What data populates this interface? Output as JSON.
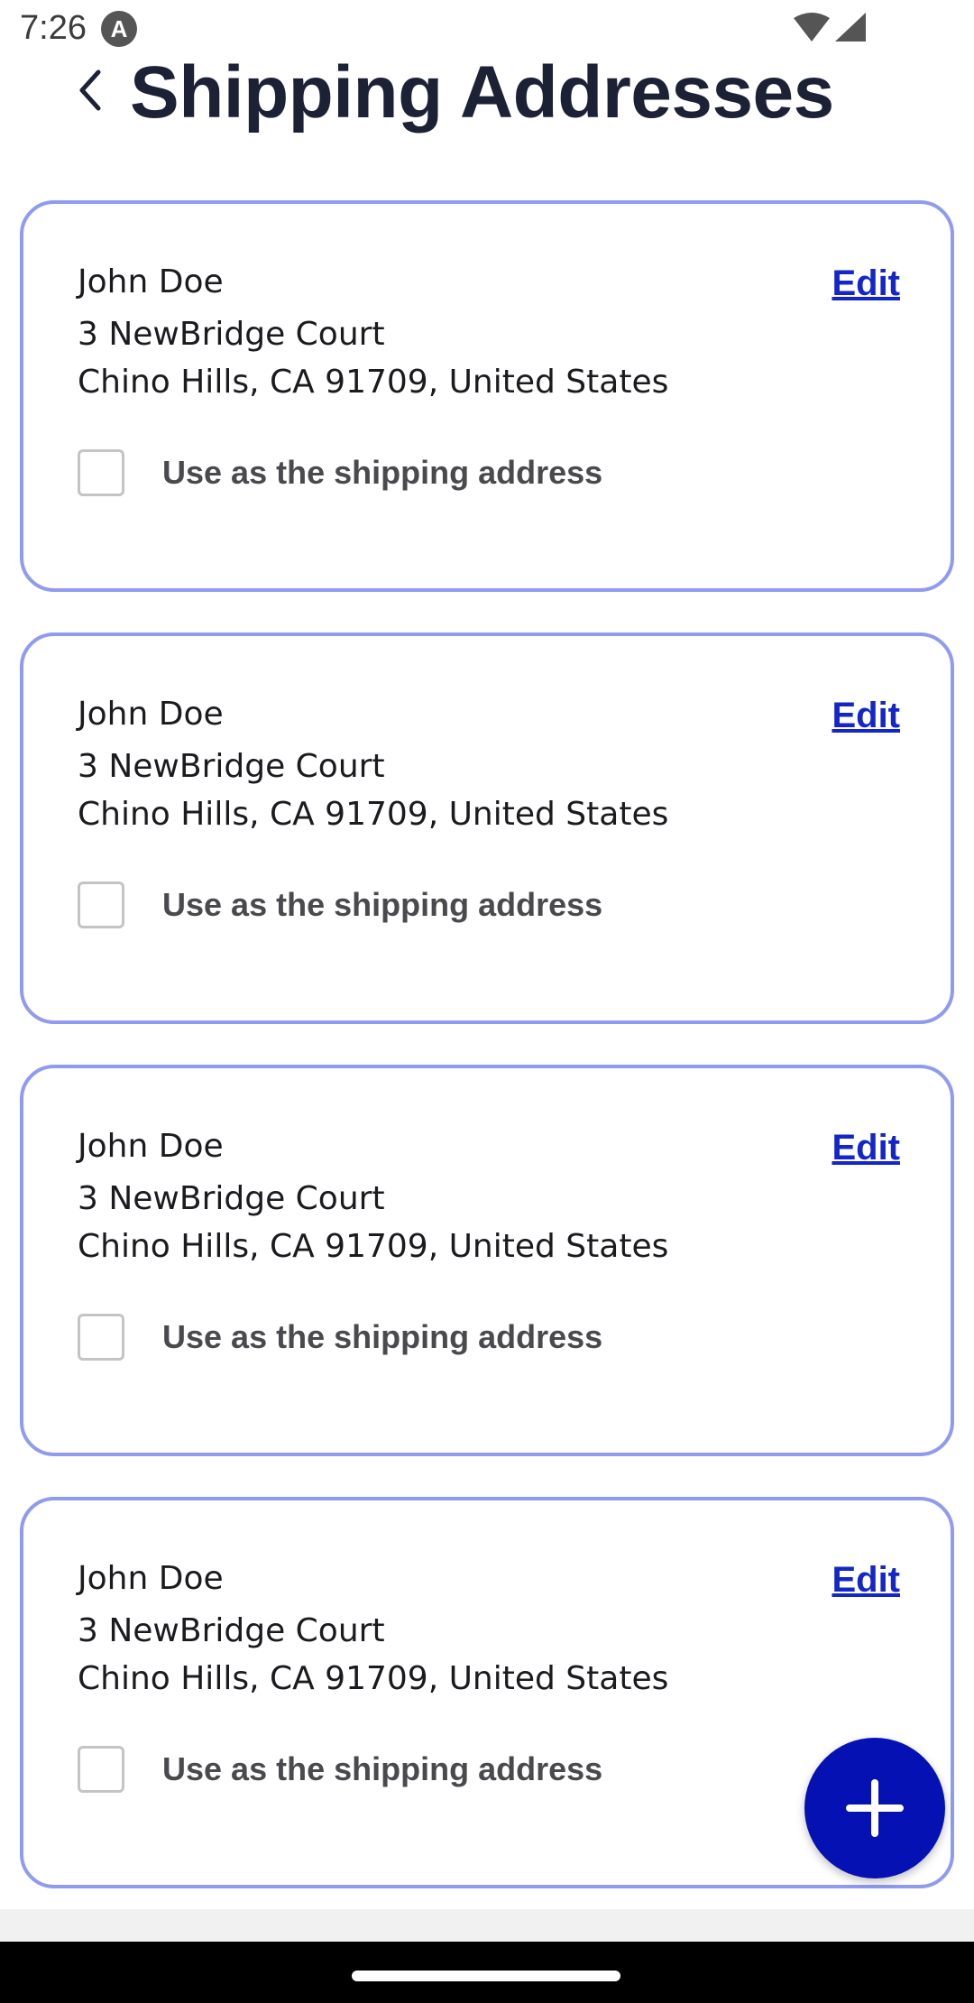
{
  "status_bar": {
    "time": "7:26",
    "app_icon": "A"
  },
  "header": {
    "title": "Shipping Addresses"
  },
  "addresses": [
    {
      "name": "John Doe",
      "line1": "3 NewBridge Court",
      "line2": "Chino Hills, CA 91709, United States",
      "edit_label": "Edit",
      "use_label": "Use as the shipping address",
      "checked": false
    },
    {
      "name": "John Doe",
      "line1": "3 NewBridge Court",
      "line2": "Chino Hills, CA 91709, United States",
      "edit_label": "Edit",
      "use_label": "Use as the shipping address",
      "checked": false
    },
    {
      "name": "John Doe",
      "line1": "3 NewBridge Court",
      "line2": "Chino Hills, CA 91709, United States",
      "edit_label": "Edit",
      "use_label": "Use as the shipping address",
      "checked": false
    },
    {
      "name": "John Doe",
      "line1": "3 NewBridge Court",
      "line2": "Chino Hills, CA 91709, United States",
      "edit_label": "Edit",
      "use_label": "Use as the shipping address",
      "checked": false
    }
  ],
  "icons": {
    "back": "chevron-left-icon",
    "add": "plus-icon",
    "wifi": "wifi-icon",
    "signal": "cell-signal-icon"
  },
  "colors": {
    "card_border": "#8e9bf0",
    "edit_link": "#1526c8",
    "fab": "#0611b4",
    "title": "#1c2136"
  }
}
